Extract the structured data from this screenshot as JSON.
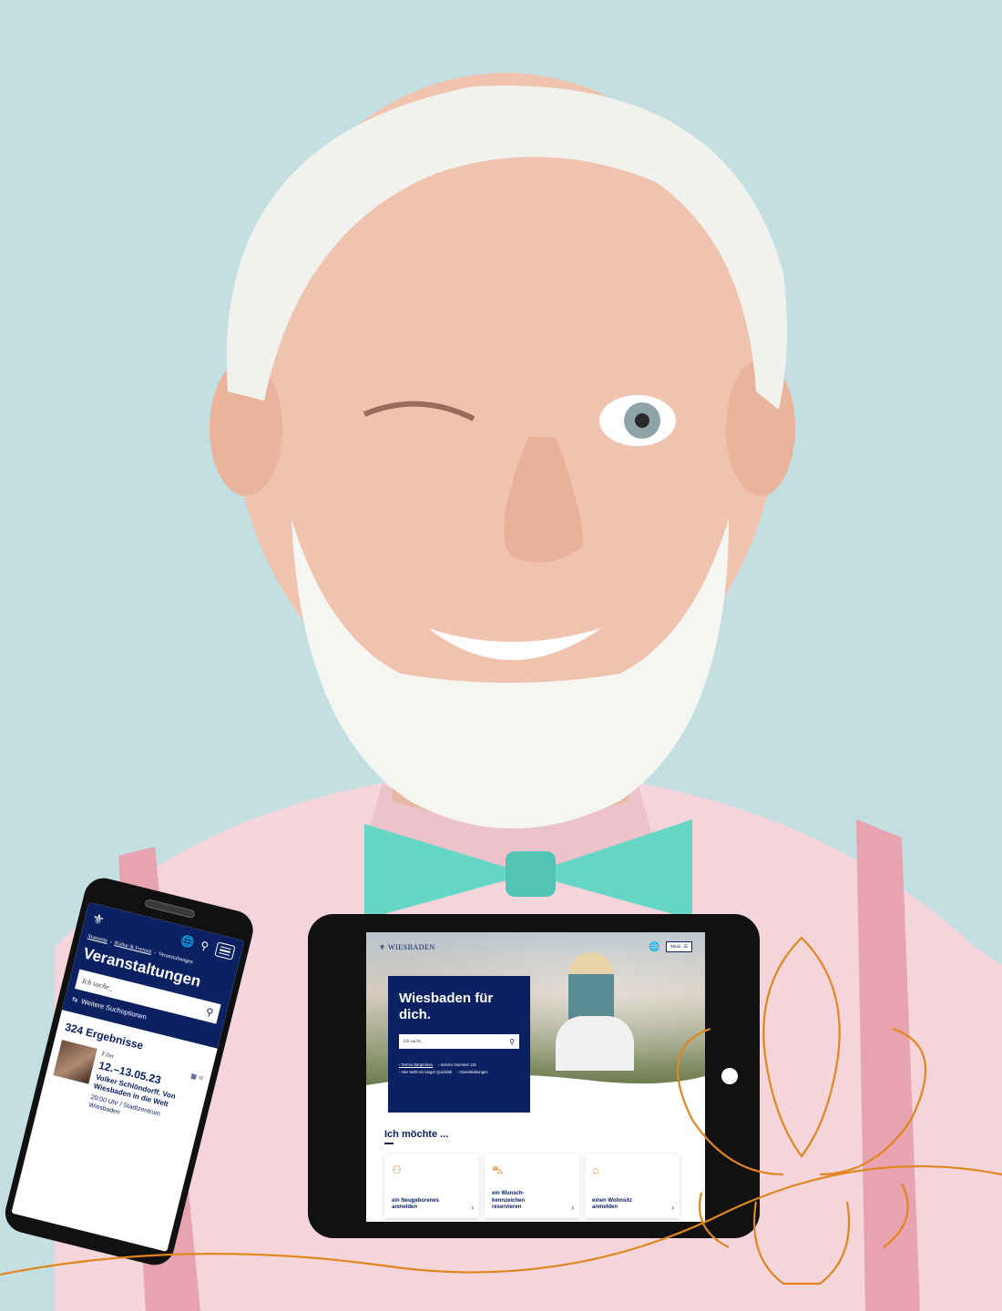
{
  "phone": {
    "breadcrumb_home": "Startseite",
    "breadcrumb_culture": "Kultur & Freizeit",
    "breadcrumb_current": "Veranstaltungen",
    "title": "Veranstaltungen",
    "search_placeholder": "Ich suche_",
    "more_options": "Weitere Suchoptionen",
    "results": "324 Ergebnisse",
    "event": {
      "category": "Film",
      "date": "12.–13.05.23",
      "title": "Volker Schlöndorff. Von Wiesbaden in die Welt",
      "time_place": "20:00 Uhr / Stadtzentrum Wiesbaden"
    }
  },
  "tablet": {
    "logo_text": "WIESBADEN",
    "menu_label": "Menü",
    "hero_title": "Wiesbaden für dich.",
    "search_placeholder": "Ich suche_",
    "quicklinks": [
      "Termin Bürgerbüro",
      "Service Nummer 115",
      "Hier steht ein langer Quicklink",
      "Dienstleistungen"
    ],
    "section_title": "Ich möchte ...",
    "tiles": [
      {
        "label": "ein Neugeborenes anmelden",
        "icon": "family-icon"
      },
      {
        "label": "ein Wunsch-kennzeichen reservieren",
        "icon": "car-icon"
      },
      {
        "label": "einen Wohnsitz anmelden",
        "icon": "house-icon"
      }
    ]
  },
  "colors": {
    "background": "#c3dfe2",
    "navy": "#0c2161",
    "orange": "#e0861e",
    "shirt": "#f5d6dc"
  }
}
